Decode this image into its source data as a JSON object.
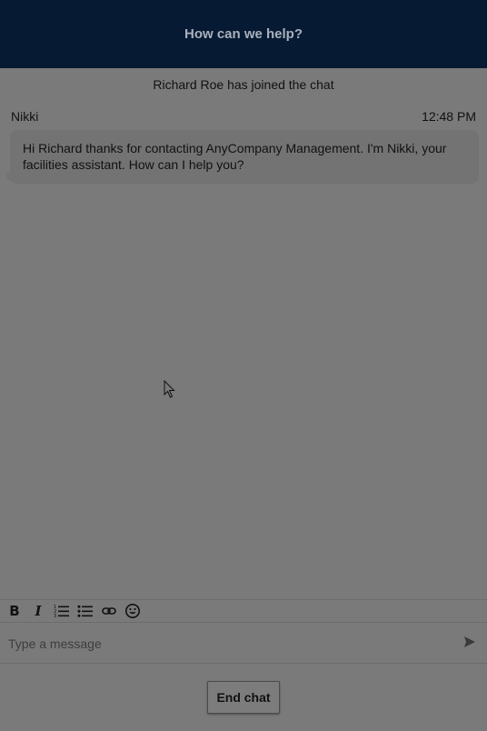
{
  "header": {
    "title": "How can we help?"
  },
  "system_message": "Richard Roe has joined the chat",
  "messages": [
    {
      "sender": "Nikki",
      "time": "12:48 PM",
      "text": "Hi Richard thanks for contacting AnyCompany Management. I'm Nikki, your facilities assistant. How can I help you?"
    }
  ],
  "toolbar": {
    "bold_icon": "bold-icon",
    "italic_icon": "italic-icon",
    "ordered_list_icon": "numbered-list-icon",
    "bullet_list_icon": "bullet-list-icon",
    "link_icon": "link-icon",
    "emoji_icon": "emoji-icon"
  },
  "composer": {
    "placeholder": "Type a message",
    "send_icon": "send-icon"
  },
  "end_chat_label": "End chat",
  "colors": {
    "header_bg": "#071a33",
    "overlay_bg": "#7a7a7a",
    "bubble_bg": "#737373"
  }
}
